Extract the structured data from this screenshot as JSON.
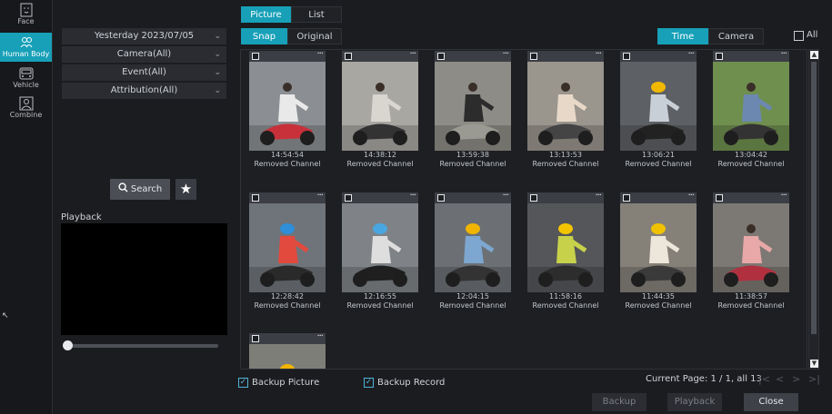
{
  "rail": {
    "items": [
      {
        "label": "Face",
        "icon": "face-icon"
      },
      {
        "label": "Human Body",
        "icon": "human-body-icon",
        "active": true
      },
      {
        "label": "Vehicle",
        "icon": "vehicle-icon"
      },
      {
        "label": "Combine",
        "icon": "combine-icon"
      }
    ]
  },
  "filters": {
    "date": "Yesterday 2023/07/05",
    "camera": "Camera(All)",
    "event": "Event(All)",
    "attribution": "Attribution(All)",
    "search_label": "Search",
    "favorite_icon": "star-icon"
  },
  "playback": {
    "label": "Playback"
  },
  "view_tabs": {
    "picture": "Picture",
    "list": "List"
  },
  "mode_tabs": {
    "snap": "Snap",
    "original": "Original"
  },
  "sort_tabs": {
    "time": "Time",
    "camera": "Camera"
  },
  "select_all_label": "All",
  "results": [
    {
      "time": "14:54:54",
      "channel": "Removed Channel"
    },
    {
      "time": "14:38:12",
      "channel": "Removed Channel"
    },
    {
      "time": "13:59:38",
      "channel": "Removed Channel"
    },
    {
      "time": "13:13:53",
      "channel": "Removed Channel"
    },
    {
      "time": "13:06:21",
      "channel": "Removed Channel"
    },
    {
      "time": "13:04:42",
      "channel": "Removed Channel"
    },
    {
      "time": "12:28:42",
      "channel": "Removed Channel"
    },
    {
      "time": "12:16:55",
      "channel": "Removed Channel"
    },
    {
      "time": "12:04:15",
      "channel": "Removed Channel"
    },
    {
      "time": "11:58:16",
      "channel": "Removed Channel"
    },
    {
      "time": "11:44:35",
      "channel": "Removed Channel"
    },
    {
      "time": "11:38:57",
      "channel": "Removed Channel"
    },
    {
      "time": "",
      "channel": ""
    }
  ],
  "bottom": {
    "backup_picture": "Backup Picture",
    "backup_record": "Backup Record",
    "page_info": "Current Page: 1 / 1, all 13",
    "backup_button": "Backup",
    "playback_button": "Playback",
    "close_button": "Close"
  },
  "colors": {
    "accent": "#17a0b8"
  }
}
